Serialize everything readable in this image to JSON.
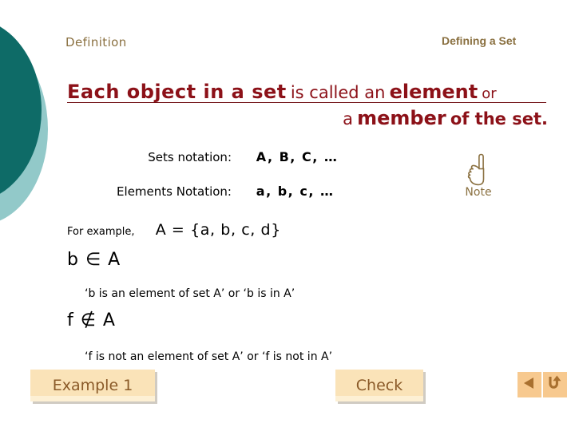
{
  "slide": {
    "header_left": "Definition",
    "header_topic": "Defining a Set",
    "accent_dark_teal": "#0e6b67",
    "accent_light_teal": "#92c9c9",
    "accent_maroon": "#8c1118",
    "accent_gold": "#8a7040",
    "button_fill": "#fae3b8",
    "button_text": "#8a5a28"
  },
  "statement": {
    "part1": "Each object in a set",
    "part2": "is called an",
    "part3": "element",
    "part4": "or",
    "part5": "a",
    "part6": "member",
    "part7": "of the set."
  },
  "notation": [
    {
      "label": "Sets notation:",
      "value": "A, B, C, …"
    },
    {
      "label": "Elements Notation:",
      "value": "a, b, c, …"
    }
  ],
  "note": {
    "icon": "pointing-hand-icon",
    "label": "Note"
  },
  "body": {
    "example_label": "For example,",
    "set_definition": "A = {a, b, c, d}",
    "membership": "b ∈ A",
    "membership_desc": "‘b is an element of set A’ or ‘b is in A’",
    "non_membership": "f ∉ A",
    "non_membership_desc": "‘f is not an element of set A’ or ‘f is not in A’"
  },
  "buttons": {
    "example": "Example 1",
    "check": "Check"
  },
  "nav": {
    "back_icon": "triangle-left-icon",
    "return_icon": "u-turn-arrow-icon"
  }
}
